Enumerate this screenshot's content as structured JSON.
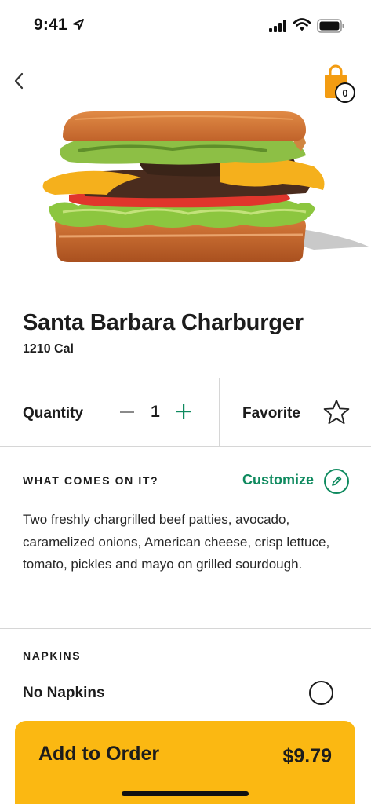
{
  "status_bar": {
    "time": "9:41"
  },
  "header": {
    "bag_count": "0"
  },
  "product": {
    "title": "Santa Barbara Charburger",
    "calories": "1210 Cal"
  },
  "quantity": {
    "label": "Quantity",
    "value": "1"
  },
  "favorite": {
    "label": "Favorite"
  },
  "ingredients": {
    "heading": "WHAT COMES ON IT?",
    "customize_label": "Customize",
    "description": "Two freshly chargrilled beef patties, avocado, caramelized onions, American cheese, crisp lettuce, tomato, pickles and mayo on grilled sourdough."
  },
  "napkins": {
    "heading": "NAPKINS",
    "option_label": "No Napkins"
  },
  "cta": {
    "label": "Add to Order",
    "price": "$9.79"
  },
  "colors": {
    "accent_green": "#0f8a5f",
    "cta_yellow": "#fbb812",
    "bag_orange": "#f39c12"
  }
}
